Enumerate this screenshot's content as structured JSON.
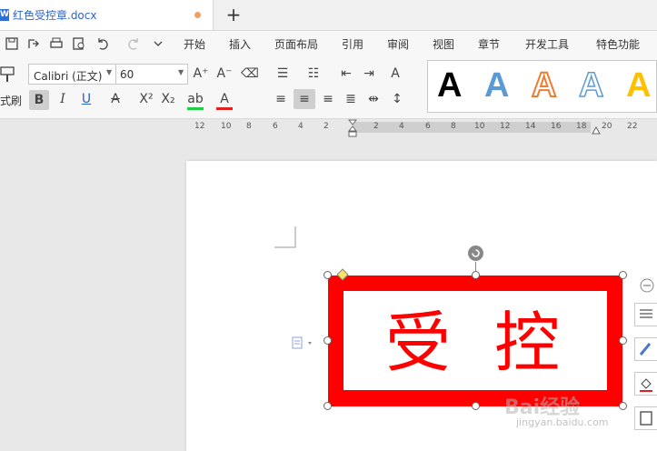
{
  "tab": {
    "title": "红色受控章.docx",
    "icon": "W",
    "new_tab": "+"
  },
  "menu": [
    "开始",
    "插入",
    "页面布局",
    "引用",
    "审阅",
    "视图",
    "章节",
    "开发工具",
    "特色功能"
  ],
  "font": {
    "family": "Calibri (正文)",
    "size": "60"
  },
  "format_painter_label": "式刷",
  "styles_preview": [
    "A",
    "A",
    "A",
    "A",
    "A"
  ],
  "ruler_labels": [
    "12",
    "10",
    "8",
    "6",
    "4",
    "2",
    "2",
    "4",
    "6",
    "8",
    "10",
    "12",
    "14",
    "16",
    "18",
    "20",
    "22"
  ],
  "stamp": {
    "char1": "受",
    "char2": "控",
    "color": "#ff0000"
  },
  "watermark": {
    "brand": "Bai经验",
    "url": "jingyan.baidu.com"
  }
}
